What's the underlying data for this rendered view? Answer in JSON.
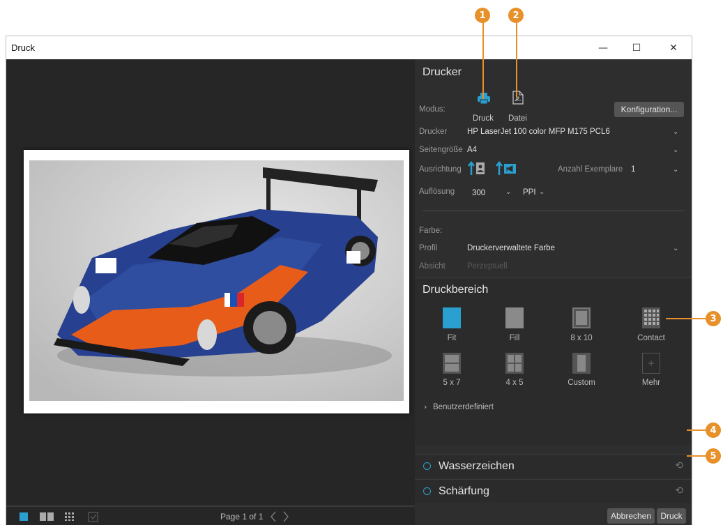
{
  "top_text": "",
  "window": {
    "title": "Druck",
    "controls": {
      "minimize": "—",
      "maximize": "☐",
      "close": "✕"
    }
  },
  "callouts": [
    "1",
    "2",
    "3",
    "4",
    "5"
  ],
  "drucker": {
    "title": "Drucker",
    "modus_label": "Modus:",
    "mode_druck": "Druck",
    "mode_datei": "Datei",
    "konfig_button": "Konfiguration...",
    "drucker_label": "Drucker",
    "drucker_value": "HP LaserJet 100 color MFP M175 PCL6",
    "seite_label": "Seitengröße",
    "seite_value": "A4",
    "ausrichtung_label": "Ausrichtung",
    "exemplare_label": "Anzahl Exemplare",
    "exemplare_value": "1",
    "aufloesung_label": "Auflösung",
    "aufloesung_value": "300",
    "ppi_value": "PPI",
    "farbe_label": "Farbe:",
    "profil_label": "Profil",
    "profil_value": "Druckerverwaltete Farbe",
    "absicht_label": "Absicht",
    "absicht_value": "Perzeptuell"
  },
  "druckbereich": {
    "title": "Druckbereich",
    "tiles": [
      "Fit",
      "Fill",
      "8 x 10",
      "Contact",
      "5 x 7",
      "4 x 5",
      "Custom",
      "Mehr"
    ],
    "benutzer": "Benutzerdefiniert"
  },
  "accordions": {
    "wasser": "Wasserzeichen",
    "schaerf": "Schärfung"
  },
  "bottom": {
    "page_info": "Page 1 of 1",
    "cancel": "Abbrechen",
    "print": "Druck"
  },
  "colors": {
    "accent": "#2aa0d0",
    "callout": "#e8902a"
  }
}
